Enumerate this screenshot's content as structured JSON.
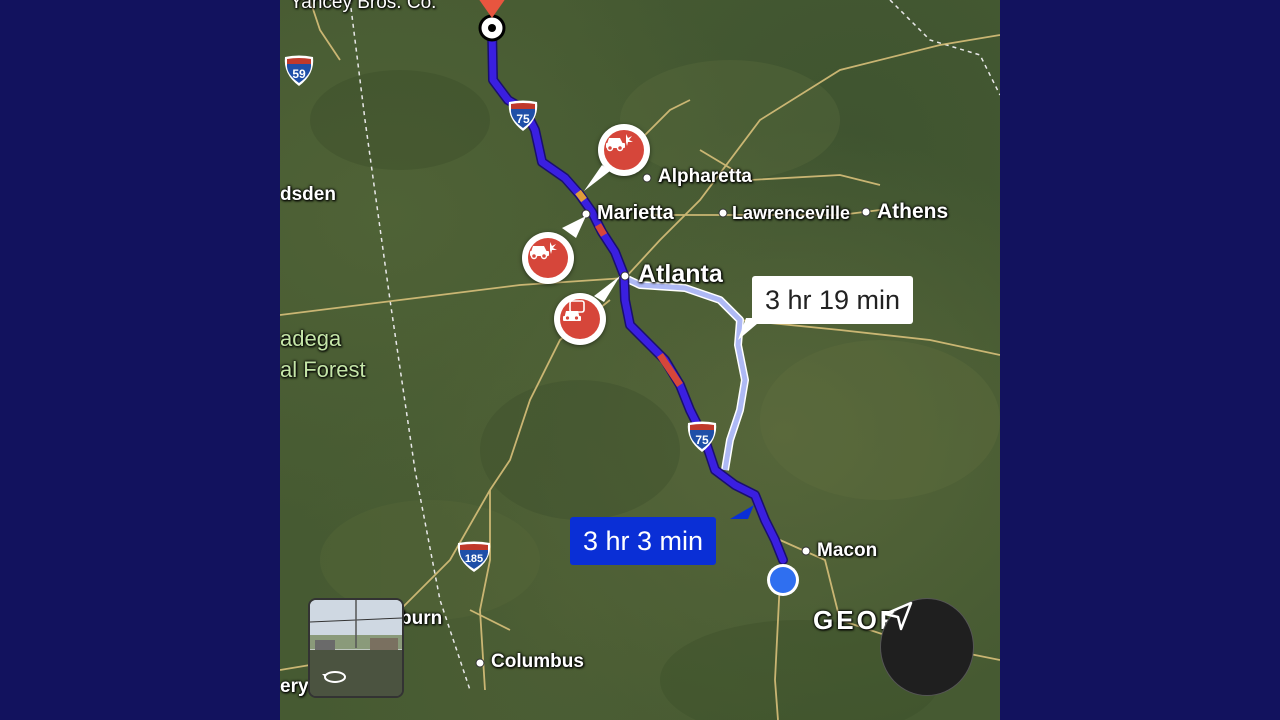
{
  "places": {
    "origin": "Yancey Bros. Co.",
    "alpharetta": "Alpharetta",
    "marietta": "Marietta",
    "lawrenceville": "Lawrenceville",
    "athens": "Athens",
    "atlanta": "Atlanta",
    "gadsden": "dsden",
    "talladega": "adega",
    "forest": "al Forest",
    "macon": "Macon",
    "georgia": "GEOR",
    "auburn": "burn",
    "columbus": "Columbus",
    "valley": "ery"
  },
  "highways": {
    "i59": "59",
    "i75_north": "75",
    "i75_south": "75",
    "i185": "185"
  },
  "routes": {
    "alternate_time": "3 hr 19 min",
    "main_time": "3 hr 3 min"
  },
  "incidents": [
    {
      "icon": "crash-icon"
    },
    {
      "icon": "crash-icon"
    },
    {
      "icon": "traffic-jam-icon"
    }
  ],
  "colors": {
    "route_main": "#3a1fe0",
    "route_alt": "#b9c4ff",
    "incident": "#d6463a",
    "destination_pin": "#e8553f",
    "current_location": "#2f6ff0",
    "background": "#12125e"
  }
}
